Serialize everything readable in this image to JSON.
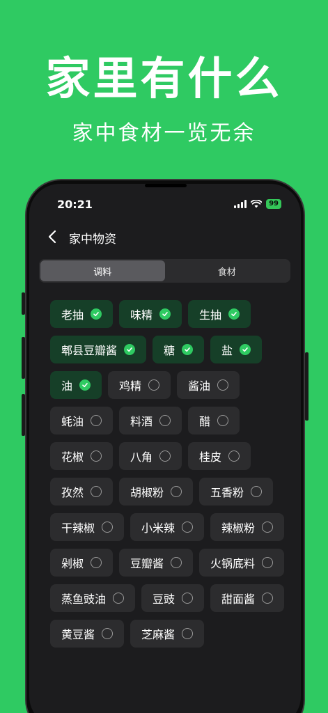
{
  "hero": {
    "title": "家里有什么",
    "subtitle": "家中食材一览无余"
  },
  "status_bar": {
    "time": "20:21",
    "battery": "99"
  },
  "nav": {
    "title": "家中物资"
  },
  "tabs": [
    {
      "label": "调料",
      "active": true
    },
    {
      "label": "食材",
      "active": false
    }
  ],
  "seasonings": [
    {
      "label": "老抽",
      "selected": true
    },
    {
      "label": "味精",
      "selected": true
    },
    {
      "label": "生抽",
      "selected": true
    },
    {
      "label": "郫县豆瓣酱",
      "selected": true
    },
    {
      "label": "糖",
      "selected": true
    },
    {
      "label": "盐",
      "selected": true
    },
    {
      "label": "油",
      "selected": true
    },
    {
      "label": "鸡精",
      "selected": false
    },
    {
      "label": "酱油",
      "selected": false
    },
    {
      "label": "蚝油",
      "selected": false
    },
    {
      "label": "料酒",
      "selected": false
    },
    {
      "label": "醋",
      "selected": false
    },
    {
      "label": "花椒",
      "selected": false
    },
    {
      "label": "八角",
      "selected": false
    },
    {
      "label": "桂皮",
      "selected": false
    },
    {
      "label": "孜然",
      "selected": false
    },
    {
      "label": "胡椒粉",
      "selected": false
    },
    {
      "label": "五香粉",
      "selected": false
    },
    {
      "label": "干辣椒",
      "selected": false
    },
    {
      "label": "小米辣",
      "selected": false
    },
    {
      "label": "辣椒粉",
      "selected": false
    },
    {
      "label": "剁椒",
      "selected": false
    },
    {
      "label": "豆瓣酱",
      "selected": false
    },
    {
      "label": "火锅底料",
      "selected": false
    },
    {
      "label": "蒸鱼豉油",
      "selected": false
    },
    {
      "label": "豆豉",
      "selected": false
    },
    {
      "label": "甜面酱",
      "selected": false
    },
    {
      "label": "黄豆酱",
      "selected": false
    },
    {
      "label": "芝麻酱",
      "selected": false
    }
  ],
  "colors": {
    "brand_green": "#2fca62",
    "selected_chip_bg": "#163f28",
    "chip_bg": "#2c2c2e",
    "screen_bg": "#1c1c1e"
  }
}
